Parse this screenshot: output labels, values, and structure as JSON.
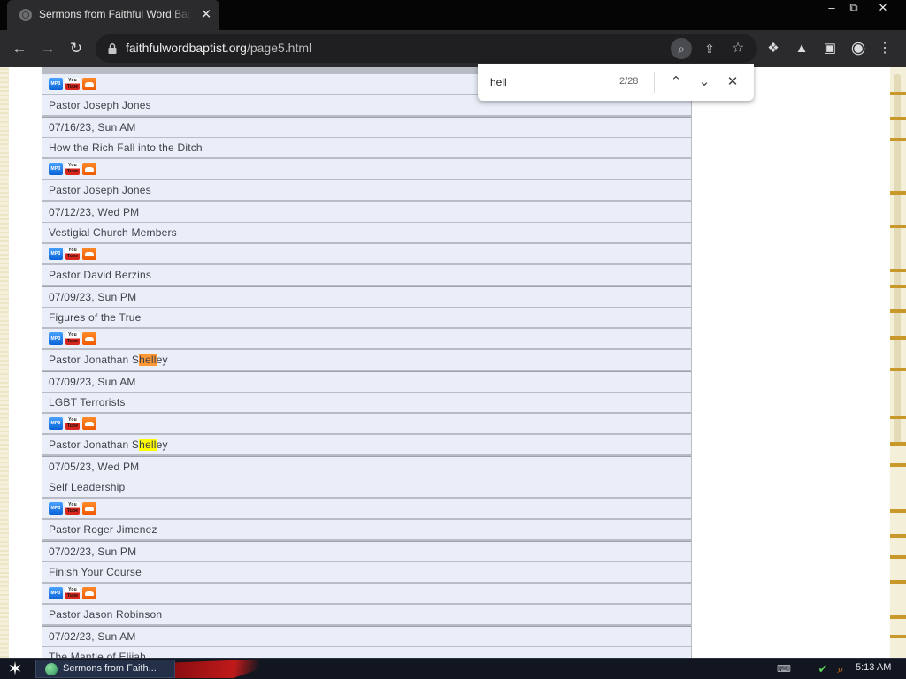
{
  "browser": {
    "tab_title": "Sermons from Faithful Word Baptist",
    "url_host": "faithfulwordbaptist.org",
    "url_path": "/page5.html",
    "window_controls": {
      "minimize": "–",
      "restore": "⧉",
      "close": "✕"
    }
  },
  "find_bar": {
    "query": "hell",
    "count": "2/28"
  },
  "page": {
    "cut_top_text": "",
    "rows": [
      {
        "type": "media"
      },
      {
        "type": "text",
        "text": "Pastor Joseph Jones"
      },
      {
        "type": "text",
        "text": "07/16/23, Sun AM",
        "group_first": true
      },
      {
        "type": "text",
        "text": "How the Rich Fall into the Ditch"
      },
      {
        "type": "media"
      },
      {
        "type": "text",
        "text": "Pastor Joseph Jones"
      },
      {
        "type": "text",
        "text": "07/12/23, Wed PM",
        "group_first": true
      },
      {
        "type": "text",
        "text": "Vestigial Church Members"
      },
      {
        "type": "media"
      },
      {
        "type": "text",
        "text": "Pastor David Berzins"
      },
      {
        "type": "text",
        "text": "07/09/23, Sun PM",
        "group_first": true
      },
      {
        "type": "text",
        "text": "Figures of the True"
      },
      {
        "type": "media"
      },
      {
        "type": "highlight",
        "before": "Pastor Jonathan S",
        "match": "hell",
        "after": "ey",
        "current": true
      },
      {
        "type": "text",
        "text": "07/09/23, Sun AM",
        "group_first": true
      },
      {
        "type": "text",
        "text": "LGBT Terrorists"
      },
      {
        "type": "media"
      },
      {
        "type": "highlight",
        "before": "Pastor Jonathan S",
        "match": "hell",
        "after": "ey",
        "current": false
      },
      {
        "type": "text",
        "text": "07/05/23, Wed PM",
        "group_first": true
      },
      {
        "type": "text",
        "text": "Self Leadership"
      },
      {
        "type": "media"
      },
      {
        "type": "text",
        "text": "Pastor Roger Jimenez"
      },
      {
        "type": "text",
        "text": "07/02/23, Sun PM",
        "group_first": true
      },
      {
        "type": "text",
        "text": "Finish Your Course"
      },
      {
        "type": "media"
      },
      {
        "type": "text",
        "text": "Pastor Jason Robinson"
      },
      {
        "type": "text",
        "text": "07/02/23, Sun AM",
        "group_first": true
      },
      {
        "type": "text",
        "text": "The Mantle of Elijah"
      }
    ],
    "media_labels": {
      "mp3": "MP3",
      "youtube": "You Tube",
      "soundcloud": ""
    }
  },
  "taskbar": {
    "task_label": "Sermons from Faith...",
    "clock": "5:13 AM"
  },
  "colors": {
    "find_current": "#ff9632",
    "find_match": "#ffff00",
    "row_bg": "#eaeef8"
  }
}
